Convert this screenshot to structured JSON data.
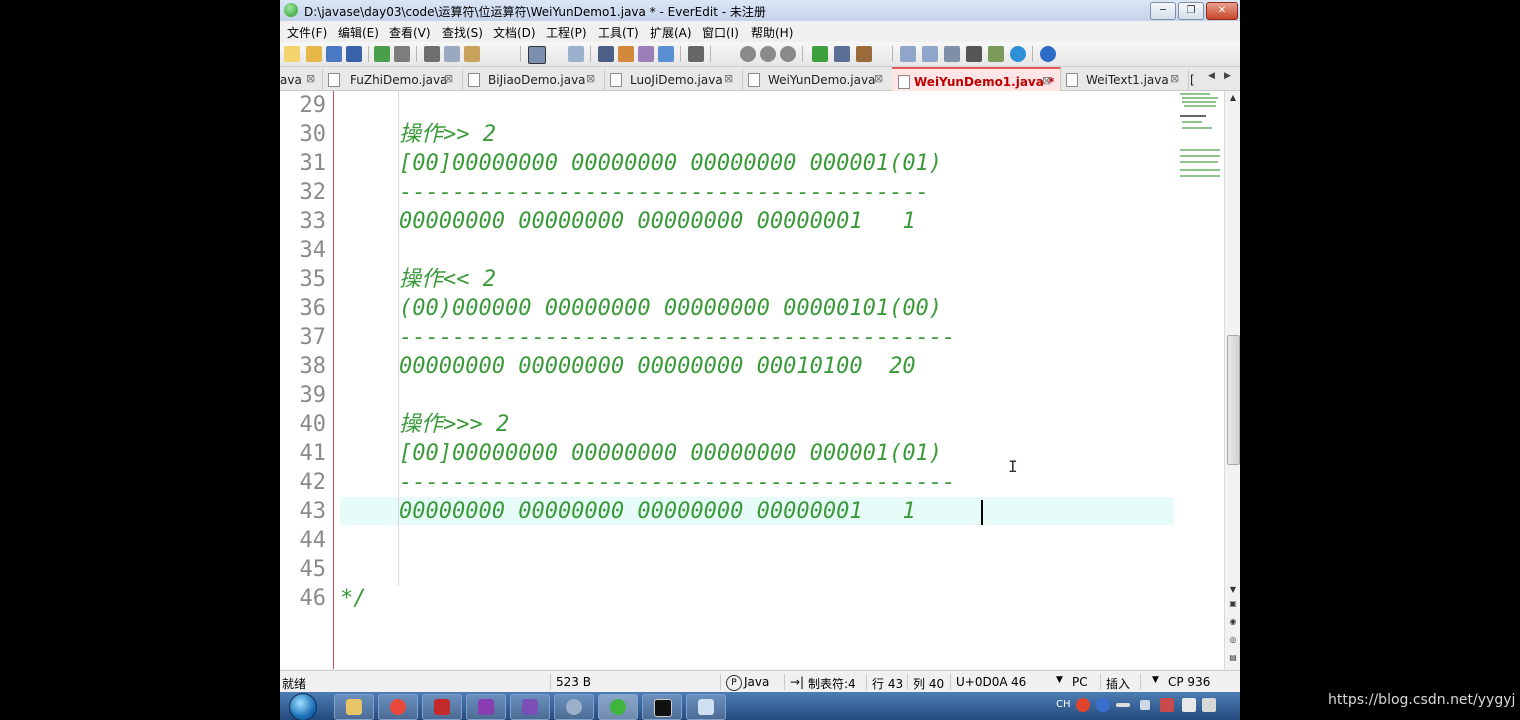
{
  "titlebar": {
    "title": "D:\\javase\\day03\\code\\运算符\\位运算符\\WeiYunDemo1.java * - EverEdit - 未注册",
    "minimize": "─",
    "maximize": "❐",
    "close": "✕"
  },
  "menu": [
    "文件(F)",
    "编辑(E)",
    "查看(V)",
    "查找(S)",
    "文档(D)",
    "工程(P)",
    "工具(T)",
    "扩展(A)",
    "窗口(I)",
    "帮助(H)"
  ],
  "tabs": [
    {
      "label": "ava",
      "active": false
    },
    {
      "label": "FuZhiDemo.java",
      "active": false
    },
    {
      "label": "BiJiaoDemo.java",
      "active": false
    },
    {
      "label": "LuoJiDemo.java",
      "active": false
    },
    {
      "label": "WeiYunDemo.java",
      "active": false
    },
    {
      "label": "WeiYunDemo1.java *",
      "active": true
    },
    {
      "label": "WeiText1.java",
      "active": false
    },
    {
      "label": "[",
      "active": false
    }
  ],
  "tab_close_glyph": "⊠",
  "editor": {
    "lines": [
      {
        "no": "29",
        "text": ""
      },
      {
        "no": "30",
        "text": "操作>> 2"
      },
      {
        "no": "31",
        "text": "[00]00000000 00000000 00000000 000001(01)"
      },
      {
        "no": "32",
        "text": "----------------------------------------"
      },
      {
        "no": "33",
        "text": "00000000 00000000 00000000 00000001   1"
      },
      {
        "no": "34",
        "text": ""
      },
      {
        "no": "35",
        "text": "操作<< 2"
      },
      {
        "no": "36",
        "text": "(00)000000 00000000 00000000 00000101(00)"
      },
      {
        "no": "37",
        "text": "------------------------------------------"
      },
      {
        "no": "38",
        "text": "00000000 00000000 00000000 00010100  20"
      },
      {
        "no": "39",
        "text": ""
      },
      {
        "no": "40",
        "text": "操作>>> 2"
      },
      {
        "no": "41",
        "text": "[00]00000000 00000000 00000000 000001(01)"
      },
      {
        "no": "42",
        "text": "------------------------------------------"
      },
      {
        "no": "43",
        "text": "00000000 00000000 00000000 00000001   1"
      },
      {
        "no": "44",
        "text": ""
      },
      {
        "no": "45",
        "text": ""
      },
      {
        "no": "46",
        "text": "*/"
      }
    ],
    "current_line": "43"
  },
  "status": {
    "state": "就绪",
    "size": "523 B",
    "language": "Java",
    "tab": "制表符:4",
    "line": "行 43",
    "col": "列 40",
    "char": "U+0D0A",
    "char_dec": "46",
    "line_ending": "PC",
    "mode": "插入",
    "codepage": "CP 936"
  },
  "taskbar": {
    "tray_lang": "CH"
  },
  "watermark": "https://blog.csdn.net/yygyj",
  "colors": {
    "code_green": "#3a9a3a",
    "active_tab_text": "#c00000",
    "gutter_border": "#d24a4a",
    "current_line_bg": "#e7fbf8"
  }
}
